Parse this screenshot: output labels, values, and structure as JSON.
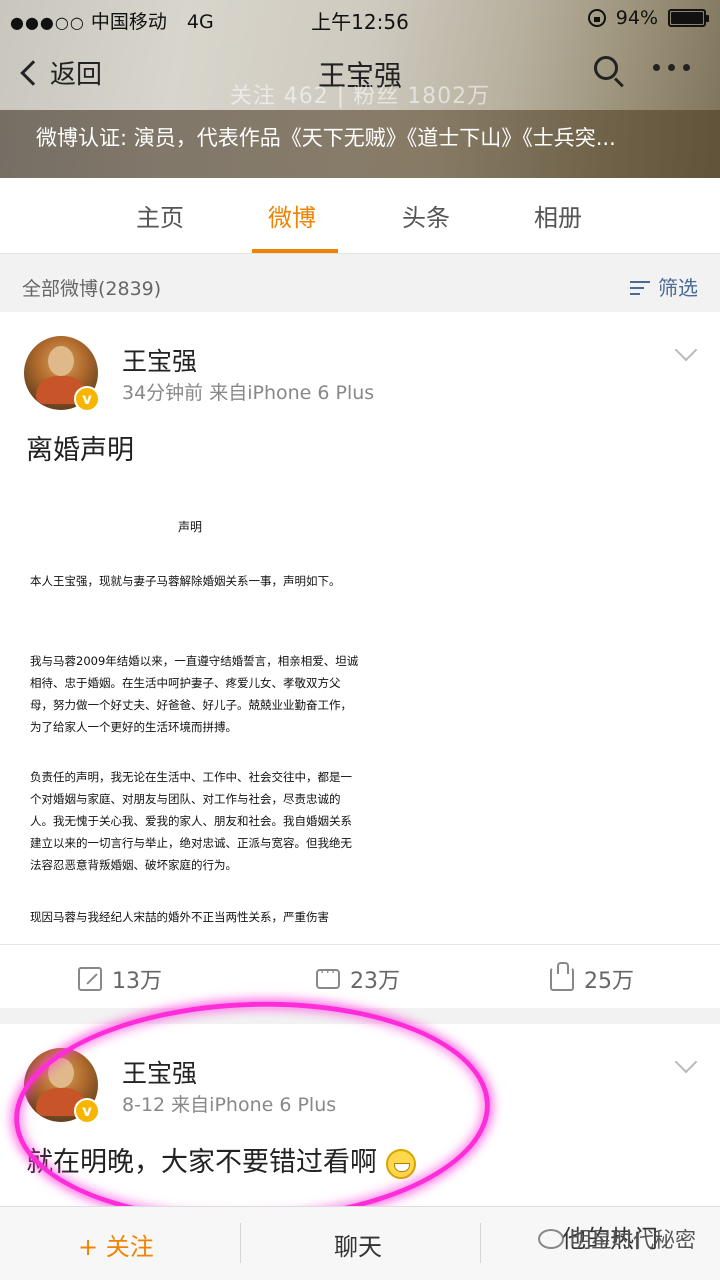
{
  "status_bar": {
    "signal": "●●●○○",
    "carrier": "中国移动",
    "network": "4G",
    "time": "上午12:56",
    "battery": "94%"
  },
  "nav": {
    "back_label": "返回",
    "title": "王宝强",
    "faded_stats": "关注 462 | 粉丝 1802万"
  },
  "profile": {
    "verification": "微博认证: 演员，代表作品《天下无贼》《道士下山》《士兵突..."
  },
  "tabs": [
    {
      "label": "主页"
    },
    {
      "label": "微博"
    },
    {
      "label": "头条"
    },
    {
      "label": "相册"
    }
  ],
  "feed": {
    "count_label": "全部微博(2839)",
    "filter_label": "筛选"
  },
  "posts": [
    {
      "author": "王宝强",
      "meta": "34分钟前  来自iPhone 6 Plus",
      "text": "离婚声明",
      "document": {
        "title": "声明",
        "p1": "本人王宝强，现就与妻子马蓉解除婚姻关系一事，声明如下。",
        "p2": "我与马蓉2009年结婚以来，一直遵守结婚誓言，相亲相爱、坦诚相待、忠于婚姻。在生活中呵护妻子、疼爱儿女、孝敬双方父母，努力做一个好丈夫、好爸爸、好儿子。兢兢业业勤奋工作，为了给家人一个更好的生活环境而拼搏。",
        "p3": "负责任的声明，我无论在生活中、工作中、社会交往中，都是一个对婚姻与家庭、对朋友与团队、对工作与社会，尽责忠诚的人。我无愧于关心我、爱我的家人、朋友和社会。我自婚姻关系建立以来的一切言行与举止，绝对忠诚、正派与宽容。但我绝无法容忍恶意背叛婚姻、破坏家庭的行为。",
        "p4": "现因马蓉与我经纪人宋喆的婚外不正当两性关系，严重伤害"
      },
      "reposts": "13万",
      "comments": "23万",
      "likes": "25万"
    },
    {
      "author": "王宝强",
      "meta": "8-12  来自iPhone 6 Plus",
      "text": "就在明晚，大家不要错过看啊"
    }
  ],
  "bottom_bar": {
    "follow": "关注",
    "chat": "聊天",
    "hot": "他的热门"
  },
  "watermark": "明星时代秘密",
  "colors": {
    "accent": "#f08300",
    "link": "#4a6b96",
    "annotation": "#ff2dd9"
  }
}
